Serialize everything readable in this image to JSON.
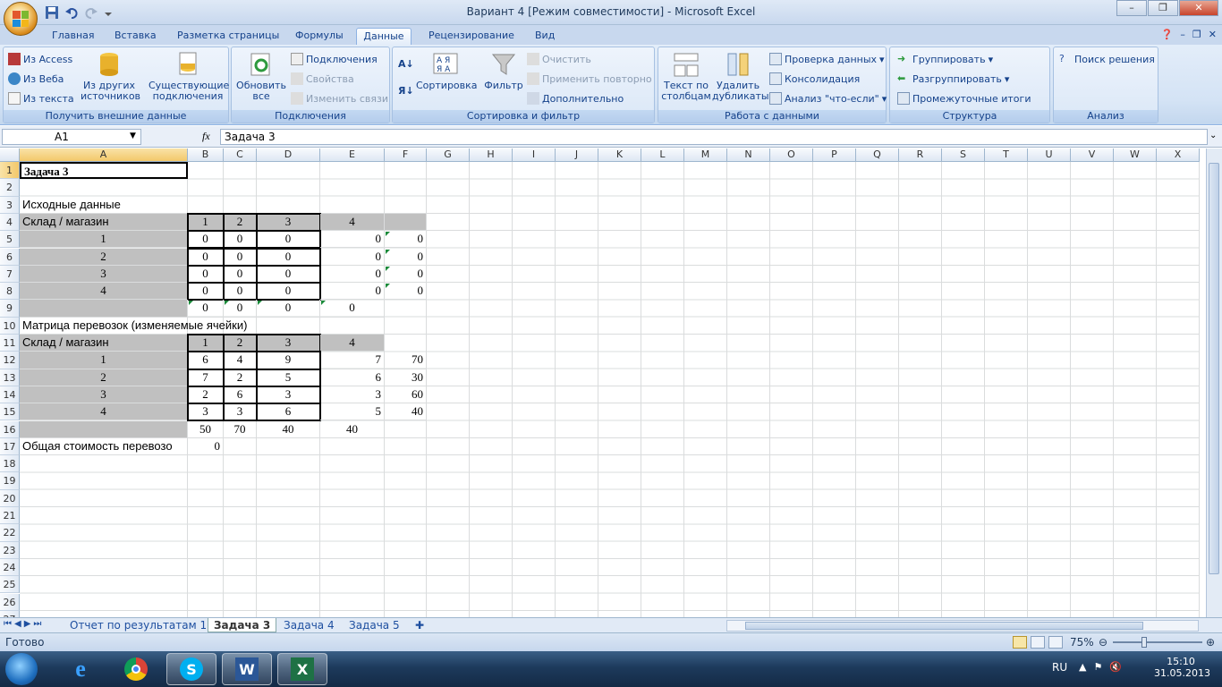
{
  "window": {
    "title": "Вариант 4  [Режим совместимости] - Microsoft Excel"
  },
  "ribbon_tabs": [
    "Главная",
    "Вставка",
    "Разметка страницы",
    "Формулы",
    "Данные",
    "Рецензирование",
    "Вид"
  ],
  "active_tab": "Данные",
  "ribbon": {
    "external": {
      "label": "Получить внешние данные",
      "from_access": "Из Access",
      "from_web": "Из Веба",
      "from_text": "Из текста",
      "from_other_1": "Из других",
      "from_other_2": "источников",
      "existing_1": "Существующие",
      "existing_2": "подключения"
    },
    "connections": {
      "label": "Подключения",
      "refresh_1": "Обновить",
      "refresh_2": "все",
      "connections": "Подключения",
      "properties": "Свойства",
      "edit_links": "Изменить связи"
    },
    "sort": {
      "label": "Сортировка и фильтр",
      "sort": "Сортировка",
      "filter": "Фильтр",
      "clear": "Очистить",
      "reapply": "Применить повторно",
      "advanced": "Дополнительно"
    },
    "datatools": {
      "label": "Работа с данными",
      "text_to_cols_1": "Текст по",
      "text_to_cols_2": "столбцам",
      "remove_dup_1": "Удалить",
      "remove_dup_2": "дубликаты",
      "validation": "Проверка данных",
      "consolidate": "Консолидация",
      "whatif": "Анализ \"что-если\""
    },
    "outline": {
      "label": "Структура",
      "group": "Группировать",
      "ungroup": "Разгруппировать",
      "subtotal": "Промежуточные итоги"
    },
    "analysis": {
      "label": "Анализ",
      "solver": "Поиск решения"
    }
  },
  "formula_bar": {
    "name_box": "A1",
    "fx": "fx",
    "formula": "Задача 3"
  },
  "columns": [
    "A",
    "B",
    "C",
    "D",
    "E",
    "F",
    "G",
    "H",
    "I",
    "J",
    "K",
    "L",
    "M",
    "N",
    "O",
    "P",
    "Q",
    "R",
    "S",
    "T",
    "U",
    "V",
    "W",
    "X"
  ],
  "rows": [
    "1",
    "2",
    "3",
    "4",
    "5",
    "6",
    "7",
    "8",
    "9",
    "10",
    "11",
    "12",
    "13",
    "14",
    "15",
    "16",
    "17",
    "18",
    "19",
    "20",
    "21",
    "22",
    "23",
    "24",
    "25",
    "26",
    "27"
  ],
  "sheet": {
    "a1": "Задача 3",
    "a3": "Исходные данные",
    "a4": "Склад / магазин",
    "a10": "Матрица перевозок (изменяемые ячейки)",
    "a11": "Склад / магазин",
    "a17": "Общая стоимость перевозо",
    "b17": "0",
    "header_1": [
      "1",
      "2",
      "3",
      "4"
    ],
    "header_2": [
      "1",
      "2",
      "3",
      "4"
    ],
    "rows_labels_1": [
      "1",
      "2",
      "3",
      "4"
    ],
    "rows_labels_2": [
      "1",
      "2",
      "3",
      "4"
    ],
    "matrix_1": [
      [
        "0",
        "0",
        "0",
        "0",
        "0"
      ],
      [
        "0",
        "0",
        "0",
        "0",
        "0"
      ],
      [
        "0",
        "0",
        "0",
        "0",
        "0"
      ],
      [
        "0",
        "0",
        "0",
        "0",
        "0"
      ]
    ],
    "row9": [
      "0",
      "0",
      "0",
      "0"
    ],
    "matrix_2": [
      [
        "6",
        "4",
        "9",
        "7",
        "70"
      ],
      [
        "7",
        "2",
        "5",
        "6",
        "30"
      ],
      [
        "2",
        "6",
        "3",
        "3",
        "60"
      ],
      [
        "3",
        "3",
        "6",
        "5",
        "40"
      ]
    ],
    "row16": [
      "50",
      "70",
      "40",
      "40"
    ]
  },
  "sheet_tabs": [
    "Отчет по результатам 1",
    "Задача 3",
    "Задача 4",
    "Задача 5"
  ],
  "active_sheet": "Задача 3",
  "status": {
    "ready": "Готово",
    "zoom": "75%"
  },
  "taskbar": {
    "lang": "RU",
    "time": "15:10",
    "date": "31.05.2013"
  }
}
